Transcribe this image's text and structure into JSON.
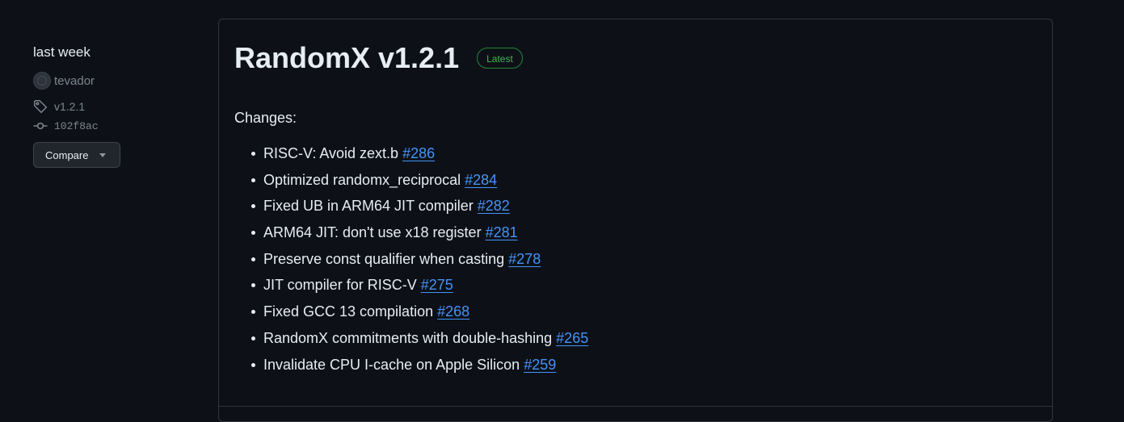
{
  "sidebar": {
    "time": "last week",
    "author": "tevador",
    "tag": "v1.2.1",
    "commit": "102f8ac",
    "compare_label": "Compare"
  },
  "release": {
    "title": "RandomX v1.2.1",
    "badge": "Latest",
    "changes_heading": "Changes:",
    "changes": [
      {
        "text": "RISC-V: Avoid zext.b",
        "pr": "#286"
      },
      {
        "text": "Optimized randomx_reciprocal",
        "pr": "#284"
      },
      {
        "text": "Fixed UB in ARM64 JIT compiler",
        "pr": "#282"
      },
      {
        "text": "ARM64 JIT: don't use x18 register",
        "pr": "#281"
      },
      {
        "text": "Preserve const qualifier when casting",
        "pr": "#278"
      },
      {
        "text": "JIT compiler for RISC-V",
        "pr": "#275"
      },
      {
        "text": "Fixed GCC 13 compilation",
        "pr": "#268"
      },
      {
        "text": "RandomX commitments with double-hashing",
        "pr": "#265"
      },
      {
        "text": "Invalidate CPU I-cache on Apple Silicon",
        "pr": "#259"
      }
    ]
  },
  "colors": {
    "background": "#0d1117",
    "link": "#4493f8",
    "badge_green": "#3fb950",
    "muted": "#7d8590"
  },
  "icons": {
    "tag": "tag-icon",
    "commit": "git-commit-icon",
    "dropdown": "triangle-down-icon"
  }
}
